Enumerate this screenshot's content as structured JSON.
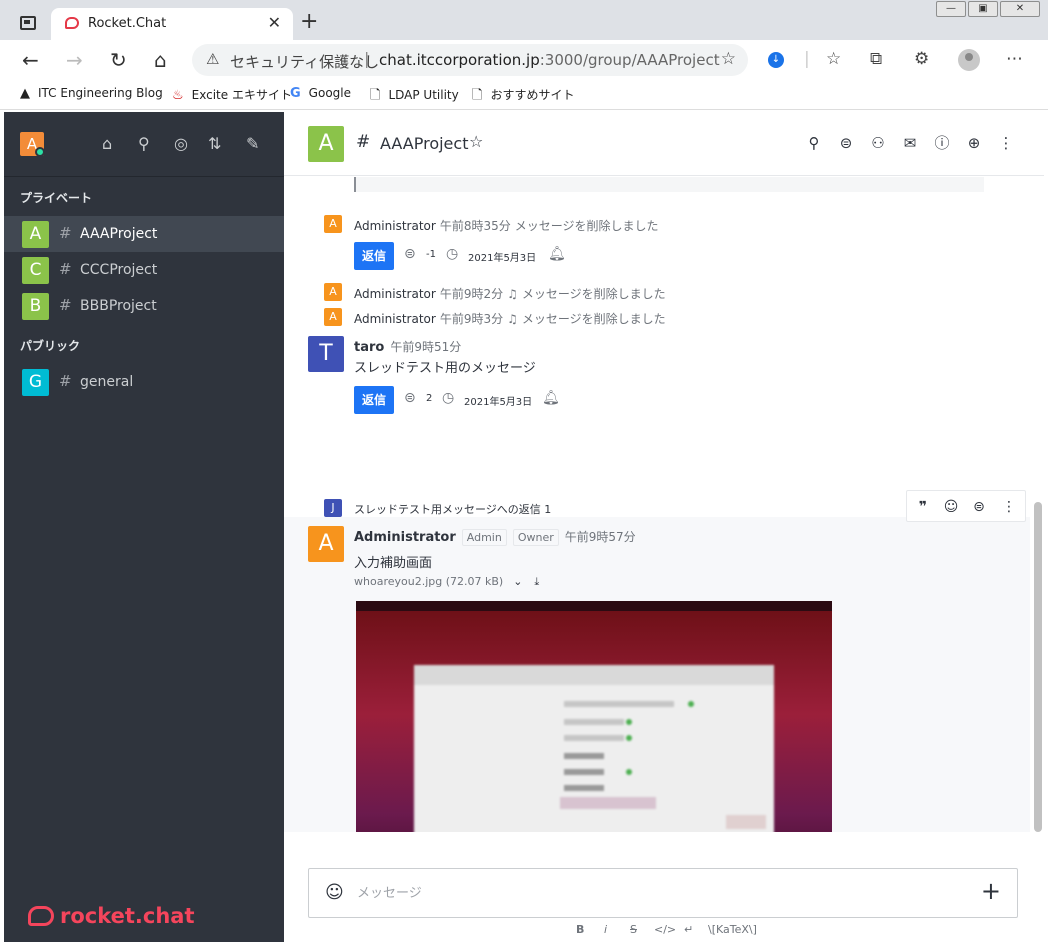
{
  "browser": {
    "tab_title": "Rocket.Chat",
    "security_label": "セキュリティ保護なし",
    "url_host": "chat.itccorporation.jp",
    "url_path": ":3000/group/AAAProject",
    "bookmarks": [
      {
        "icon": "▲",
        "label": "ITC Engineering Blog"
      },
      {
        "icon": "♨",
        "label": "Excite エキサイト"
      },
      {
        "icon": "G",
        "label": "Google"
      },
      {
        "icon": "🗋",
        "label": "LDAP Utility"
      },
      {
        "icon": "🗋",
        "label": "おすすめサイト"
      }
    ]
  },
  "sidebar": {
    "user_initial": "A",
    "section_private": "プライベート",
    "section_public": "パブリック",
    "private_rooms": [
      {
        "initial": "A",
        "name": "AAAProject",
        "color": "#8bc34a"
      },
      {
        "initial": "C",
        "name": "CCCProject",
        "color": "#8bc34a"
      },
      {
        "initial": "B",
        "name": "BBBProject",
        "color": "#8bc34a"
      }
    ],
    "public_rooms": [
      {
        "initial": "G",
        "name": "general",
        "color": "#00bcd4"
      }
    ],
    "logo_text": "rocket.chat"
  },
  "room": {
    "initial": "A",
    "title": "AAAProject"
  },
  "messages": {
    "sys1": {
      "initial": "A",
      "user": "Administrator",
      "time": "午前8時35分",
      "text": "メッセージを削除しました"
    },
    "thread1": {
      "reply_label": "返信",
      "count": "-1",
      "date": "2021年5月3日"
    },
    "sys2": {
      "initial": "A",
      "user": "Administrator",
      "time": "午前9時2分",
      "text": "メッセージを削除しました"
    },
    "sys3": {
      "initial": "A",
      "user": "Administrator",
      "time": "午前9時3分",
      "text": "メッセージを削除しました"
    },
    "taro": {
      "initial": "T",
      "user": "taro",
      "time": "午前9時51分",
      "text": "スレッドテスト用のメッセージ"
    },
    "thread2": {
      "reply_label": "返信",
      "count": "2",
      "date": "2021年5月3日"
    },
    "reply_preview": {
      "initial": "J",
      "text": "スレッドテスト用メッセージへの返信 1"
    },
    "admin": {
      "initial": "A",
      "user": "Administrator",
      "badge_admin": "Admin",
      "badge_owner": "Owner",
      "time": "午前9時57分",
      "text": "入力補助画面",
      "file_name": "whoareyou2.jpg (72.07 kB)"
    }
  },
  "composer": {
    "placeholder": "メッセージ",
    "format_bold": "B",
    "format_italic": "i",
    "format_strike": "S",
    "format_code": "</>",
    "format_multiline": "↵",
    "format_katex": "\\[KaTeX\\]"
  }
}
